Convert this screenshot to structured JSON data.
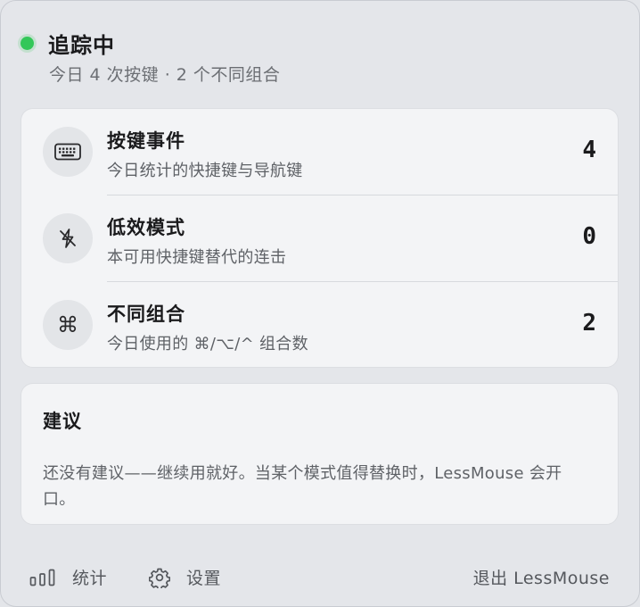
{
  "header": {
    "status_title": "追踪中",
    "status_subtitle": "今日 4 次按键 · 2 个不同组合",
    "status_color": "#33c759"
  },
  "stats": [
    {
      "icon": "keyboard-icon",
      "title": "按键事件",
      "description": "今日统计的快捷键与导航键",
      "value": "4"
    },
    {
      "icon": "lightning-slash-icon",
      "title": "低效模式",
      "description": "本可用快捷键替代的连击",
      "value": "0"
    },
    {
      "icon": "command-icon",
      "icon_glyph": "⌘",
      "title": "不同组合",
      "description": "今日使用的 ⌘/⌥/^ 组合数",
      "value": "2"
    }
  ],
  "suggestions": {
    "title": "建议",
    "body": "还没有建议——继续用就好。当某个模式值得替换时，LessMouse 会开口。"
  },
  "footer": {
    "stats_label": "统计",
    "settings_label": "设置",
    "quit_label": "退出 LessMouse"
  }
}
